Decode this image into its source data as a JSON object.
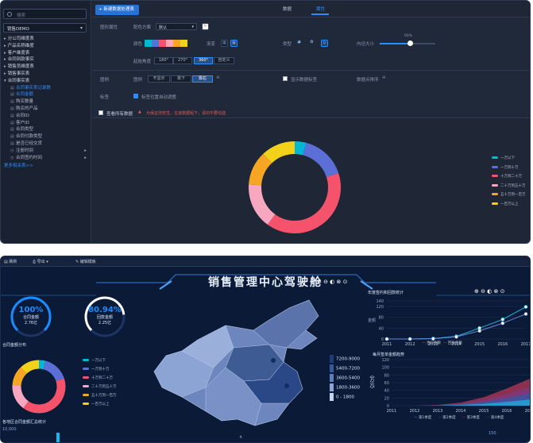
{
  "editor": {
    "search": {
      "placeholder": "搜索"
    },
    "dataset": "销售DEMO",
    "tree": [
      {
        "label": "分公司维度表",
        "kind": "group"
      },
      {
        "label": "产品名称维度",
        "kind": "group"
      },
      {
        "label": "客户维度表",
        "kind": "group"
      },
      {
        "label": "合同到款事实",
        "kind": "group"
      },
      {
        "label": "销售员维度表",
        "kind": "group"
      },
      {
        "label": "销售事实表",
        "kind": "group"
      },
      {
        "label": "合同事实表",
        "kind": "open"
      },
      {
        "label": "合同事实表记录数",
        "kind": "field",
        "icon": "▤",
        "active": true
      },
      {
        "label": "合同金额",
        "kind": "field",
        "icon": "▤",
        "active": true
      },
      {
        "label": "购买数量",
        "kind": "field",
        "icon": "▤"
      },
      {
        "label": "购买的产品",
        "kind": "field",
        "icon": "▤"
      },
      {
        "label": "合同ID",
        "kind": "field",
        "icon": "▤"
      },
      {
        "label": "客户ID",
        "kind": "field",
        "icon": "▤"
      },
      {
        "label": "合同类型",
        "kind": "field",
        "icon": "▤"
      },
      {
        "label": "合同付款类型",
        "kind": "field",
        "icon": "▤"
      },
      {
        "label": "是否已经交货",
        "kind": "field",
        "icon": "▤"
      },
      {
        "label": "注册时间",
        "kind": "field",
        "icon": "◷",
        "sub": true
      },
      {
        "label": "合同签约时间",
        "kind": "field",
        "icon": "◷",
        "sub": true
      }
    ],
    "more_link": "更多相关表>>",
    "pill": "+ 新建数据处理表",
    "tabs": [
      "数据",
      "属性"
    ],
    "config": {
      "graph_prop": "图形属性",
      "color_label": "颜色",
      "color_scheme_label": "配色方案",
      "color_scheme_value": "默认",
      "gradient_label": "渐变",
      "type_label": "类型",
      "inner_radius_label": "内径大小",
      "inner_radius_value": "60%",
      "start_angle_label": "起始角度",
      "angles": [
        "180°",
        "270°",
        "360°",
        "自定义"
      ],
      "legend_row_label": "图例",
      "legend_label": "图例",
      "legend_options": [
        "不显示",
        "靠下",
        "靠右"
      ],
      "show_label": "显示数据标签",
      "data_sort_label": "数据点排序",
      "data_label": "标签",
      "auto_label": "标签位置自动调整",
      "show_all": "查看所有数据",
      "warning": "为保证浏览性，在该数据组下，请勿不要勾选"
    },
    "chart_data": {
      "type": "pie",
      "categories": [
        "一万以下",
        "一万到十万",
        "十万到二十万",
        "二十万到五十万",
        "五十万到一百万",
        "一百万以上"
      ],
      "values": [
        4,
        16,
        40,
        16,
        12,
        12
      ],
      "colors": [
        "#00b8d4",
        "#5b6fd6",
        "#f5536c",
        "#f7a8c0",
        "#f6a623",
        "#f2d11a"
      ]
    }
  },
  "dashboard": {
    "toolbar": [
      "刷新",
      "导出",
      "编辑模板"
    ],
    "title": "销售管理中心驾驶舱",
    "gauges": [
      {
        "percent": "100%",
        "line1": "合同金额",
        "line2": "2.76亿",
        "color": "#1a8cff",
        "value": 1.0
      },
      {
        "percent": "80.94%",
        "line1": "回款金额",
        "line2": "2.25亿",
        "color": "#ffffff",
        "value": 0.8094
      }
    ],
    "pie_title": "合同金额分布",
    "pie_legend": [
      "一万以下",
      "一万到十万",
      "十万到二十万",
      "二十万到五十万",
      "五十万到一百万",
      "一百万以上"
    ],
    "bottom_left_title": "各地区合同金额汇总统计",
    "bottom_left_tick": "10,000",
    "map_legend": [
      "7200-9000",
      "5400-7200",
      "3600-5400",
      "1800-3600",
      "0 - 1800"
    ],
    "map_legend_colors": [
      "#1e3c7a",
      "#345a9b",
      "#5a7fbd",
      "#8aa5d6",
      "#c5d3ee"
    ],
    "map_unit": "（万元）",
    "line_chart": {
      "title": "年度签约和回款统计",
      "x": [
        "2011",
        "2012",
        "2013",
        "2014",
        "2015",
        "2016",
        "2017"
      ],
      "yticks": [
        "140",
        "120",
        "80",
        "40",
        "0"
      ],
      "series": [
        {
          "name": "合同金额",
          "values": [
            0,
            0,
            2,
            10,
            40,
            72,
            118
          ]
        },
        {
          "name": "回款金额",
          "values": [
            0,
            0,
            1,
            8,
            30,
            58,
            92
          ]
        }
      ],
      "ylabel": "金额"
    },
    "area_chart": {
      "title": "每月签单金额趋势",
      "x": [
        "2011",
        "2012",
        "2013",
        "2014",
        "2015",
        "2016",
        "2017"
      ],
      "yticks": [
        "120",
        "100",
        "80",
        "60",
        "40",
        "20",
        "0"
      ],
      "legend": [
        "第1季度",
        "第2季度",
        "第3季度",
        "第4季度"
      ],
      "ylabel": "金额"
    }
  }
}
